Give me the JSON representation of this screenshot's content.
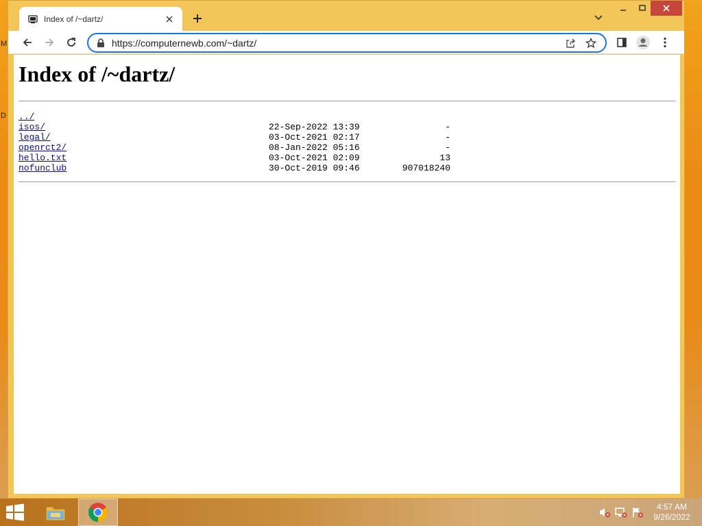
{
  "desktop": {
    "edge_letters": [
      "M",
      "D"
    ]
  },
  "browser": {
    "tab": {
      "title": "Index of /~dartz/"
    },
    "address": {
      "url": "https://computernewb.com/~dartz/"
    }
  },
  "page": {
    "heading": "Index of /~dartz/",
    "entries": [
      {
        "name": "../",
        "date": "",
        "size": ""
      },
      {
        "name": "isos/",
        "date": "22-Sep-2022 13:39",
        "size": "-"
      },
      {
        "name": "legal/",
        "date": "03-Oct-2021 02:17",
        "size": "-"
      },
      {
        "name": "openrct2/",
        "date": "08-Jan-2022 05:16",
        "size": "-"
      },
      {
        "name": "hello.txt",
        "date": "03-Oct-2021 02:09",
        "size": "13"
      },
      {
        "name": "nofunclub",
        "date": "30-Oct-2019 09:46",
        "size": "907018240"
      }
    ]
  },
  "taskbar": {
    "clock_time": "4:57 AM",
    "clock_date": "9/26/2022",
    "apps": [
      "file-explorer",
      "chrome"
    ]
  },
  "colors": {
    "window_frame": "#f2c659",
    "close_button": "#c7463c",
    "link": "#0b0b8b",
    "omnibox_border": "#1a73e8"
  }
}
